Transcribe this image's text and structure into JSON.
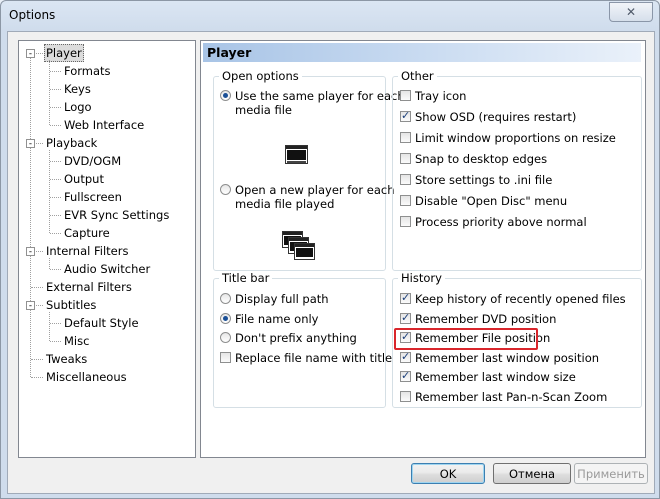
{
  "window": {
    "title": "Options"
  },
  "tree": {
    "items": [
      {
        "label": "Player",
        "level": 0,
        "expander": "-"
      },
      {
        "label": "Formats",
        "level": 1
      },
      {
        "label": "Keys",
        "level": 1
      },
      {
        "label": "Logo",
        "level": 1
      },
      {
        "label": "Web Interface",
        "level": 1
      },
      {
        "label": "Playback",
        "level": 0,
        "expander": "-"
      },
      {
        "label": "DVD/OGM",
        "level": 1
      },
      {
        "label": "Output",
        "level": 1
      },
      {
        "label": "Fullscreen",
        "level": 1
      },
      {
        "label": "EVR Sync Settings",
        "level": 1
      },
      {
        "label": "Capture",
        "level": 1
      },
      {
        "label": "Internal Filters",
        "level": 0,
        "expander": "-"
      },
      {
        "label": "Audio Switcher",
        "level": 1
      },
      {
        "label": "External Filters",
        "level": 0
      },
      {
        "label": "Subtitles",
        "level": 0,
        "expander": "-"
      },
      {
        "label": "Default Style",
        "level": 1
      },
      {
        "label": "Misc",
        "level": 1
      },
      {
        "label": "Tweaks",
        "level": 0
      },
      {
        "label": "Miscellaneous",
        "level": 0
      }
    ]
  },
  "page": {
    "header": "Player",
    "open_options": {
      "title": "Open options",
      "same_player": "Use the same player for each media file",
      "same_player_line1": "Use the same player for each",
      "same_player_line2": "media file",
      "new_player_line1": "Open a new player for each",
      "new_player_line2": "media file played"
    },
    "other": {
      "title": "Other",
      "items": [
        {
          "label": "Tray icon",
          "checked": false
        },
        {
          "label": "Show OSD (requires restart)",
          "checked": true
        },
        {
          "label": "Limit window proportions on resize",
          "checked": false
        },
        {
          "label": "Snap to desktop edges",
          "checked": false
        },
        {
          "label": "Store settings to .ini file",
          "checked": false
        },
        {
          "label": "Disable \"Open Disc\" menu",
          "checked": false
        },
        {
          "label": "Process priority above normal",
          "checked": false
        }
      ]
    },
    "title_bar": {
      "title": "Title bar",
      "radios": [
        {
          "label": "Display full path",
          "selected": false
        },
        {
          "label": "File name only",
          "selected": true
        },
        {
          "label": "Don't prefix anything",
          "selected": false
        }
      ],
      "replace_label": "Replace file name with title",
      "replace_checked": false
    },
    "history": {
      "title": "History",
      "items": [
        {
          "label": "Keep history of recently opened files",
          "checked": true
        },
        {
          "label": "Remember DVD position",
          "checked": true
        },
        {
          "label": "Remember File position",
          "checked": true
        },
        {
          "label": "Remember last window position",
          "checked": true
        },
        {
          "label": "Remember last window size",
          "checked": true
        },
        {
          "label": "Remember last Pan-n-Scan Zoom",
          "checked": false
        }
      ]
    }
  },
  "buttons": {
    "ok": "OK",
    "cancel": "Отмена",
    "apply": "Применить"
  },
  "colors": {
    "highlight": "#d9262c",
    "header_gradient": "#a8c4e6"
  }
}
